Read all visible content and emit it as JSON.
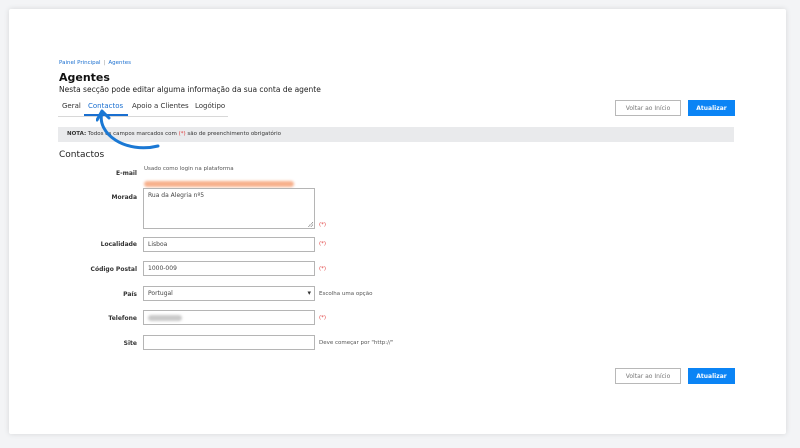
{
  "breadcrumb": {
    "home": "Painel Principal",
    "separator": "|",
    "current": "Agentes"
  },
  "header": {
    "title": "Agentes",
    "subtitle": "Nesta secção pode editar alguma informação da sua conta de agente"
  },
  "tabs": [
    {
      "label": "Geral",
      "active": false
    },
    {
      "label": "Contactos",
      "active": true
    },
    {
      "label": "Apoio a Clientes",
      "active": false
    },
    {
      "label": "Logótipo",
      "active": false
    }
  ],
  "buttons": {
    "back_label": "Voltar ao Início",
    "update_label": "Atualizar"
  },
  "note": {
    "prefix": "NOTA:",
    "text_start": "Todos os campos marcados com",
    "required_marker": "(*)",
    "text_end": "são de preenchimento obrigatório"
  },
  "section": {
    "title": "Contactos"
  },
  "form": {
    "email": {
      "label": "E-mail",
      "hint": "Usado como login na plataforma"
    },
    "address": {
      "label": "Morada",
      "value": "Rua da Alegria nº5",
      "required": "(*)"
    },
    "locality": {
      "label": "Localidade",
      "value": "Lisboa",
      "required": "(*)"
    },
    "postal_code": {
      "label": "Código Postal",
      "value": "1000-009",
      "required": "(*)"
    },
    "country": {
      "label": "País",
      "value": "Portugal",
      "hint": "Escolha uma opção"
    },
    "phone": {
      "label": "Telefone",
      "required": "(*)"
    },
    "site": {
      "label": "Site",
      "value": "",
      "hint": "Deve começar por \"http://\""
    }
  },
  "colors": {
    "accent": "#0b84f5",
    "link": "#1a6fd0",
    "required": "#e03a3a",
    "annotation": "#1a78d4"
  },
  "icons": {
    "select": "chevron-down-icon",
    "annotation": "curved-arrow-icon"
  }
}
